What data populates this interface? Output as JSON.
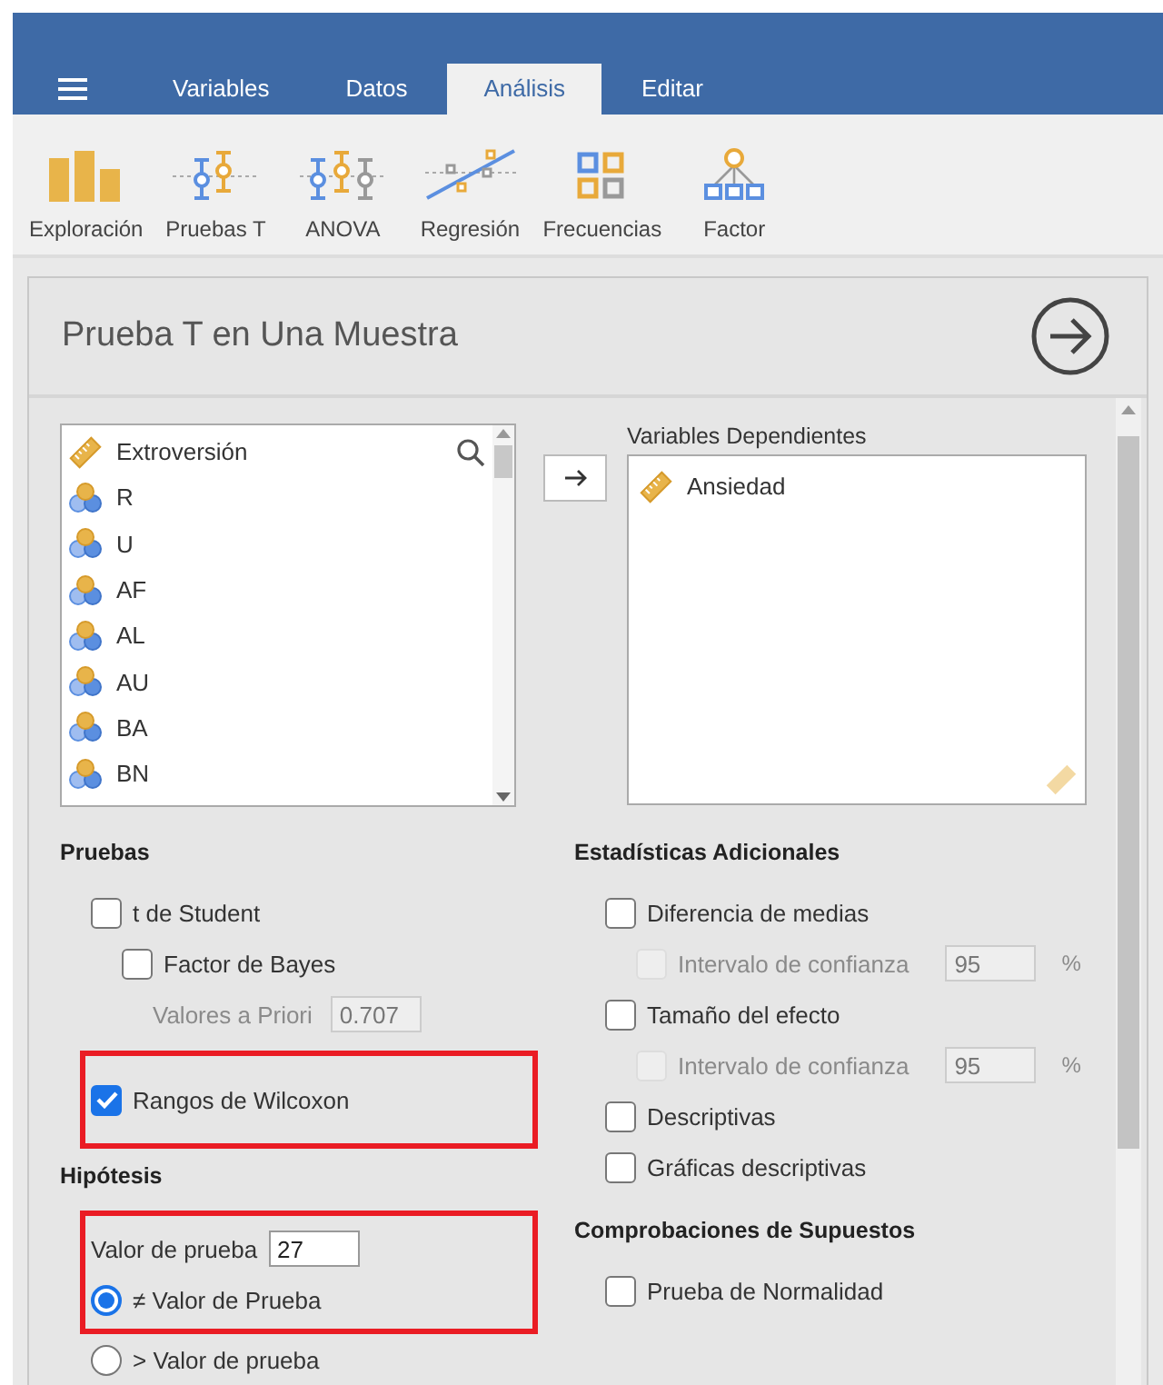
{
  "menu_tabs": [
    {
      "label": "Variables",
      "selected": false
    },
    {
      "label": "Datos",
      "selected": false
    },
    {
      "label": "Análisis",
      "selected": true
    },
    {
      "label": "Editar",
      "selected": false
    }
  ],
  "toolbar": [
    {
      "label": "Exploración",
      "kind": "bars"
    },
    {
      "label": "Pruebas T",
      "kind": "ttest"
    },
    {
      "label": "ANOVA",
      "kind": "anova"
    },
    {
      "label": "Regresión",
      "kind": "regression"
    },
    {
      "label": "Frecuencias",
      "kind": "grid"
    },
    {
      "label": "Factor",
      "kind": "tree"
    }
  ],
  "panel": {
    "title": "Prueba T en Una Muestra"
  },
  "variables": [
    {
      "name": "Extroversión",
      "kind": "continuous"
    },
    {
      "name": "R",
      "kind": "nominal"
    },
    {
      "name": "U",
      "kind": "nominal"
    },
    {
      "name": "AF",
      "kind": "nominal"
    },
    {
      "name": "AL",
      "kind": "nominal"
    },
    {
      "name": "AU",
      "kind": "nominal"
    },
    {
      "name": "BA",
      "kind": "nominal"
    },
    {
      "name": "BN",
      "kind": "nominal"
    }
  ],
  "dependent": {
    "label": "Variables Dependientes",
    "items": [
      {
        "name": "Ansiedad",
        "kind": "continuous"
      }
    ]
  },
  "tests": {
    "title": "Pruebas",
    "options": [
      {
        "kind": "check",
        "label": "t de Student",
        "checked": false,
        "children": [
          {
            "kind": "check",
            "label": "Factor de Bayes",
            "checked": false,
            "children": [
              {
                "kind": "field",
                "label": "Valores a Priori",
                "value": "0.707",
                "disabled": true
              }
            ]
          }
        ]
      },
      {
        "kind": "check",
        "label": "Rangos de Wilcoxon",
        "checked": true,
        "highlighted": true
      }
    ]
  },
  "hypothesis": {
    "title": "Hipótesis",
    "test_value_label": "Valor de prueba",
    "test_value": "27",
    "test_value_highlighted": true,
    "options": [
      {
        "label": "≠ Valor de Prueba",
        "selected": true,
        "highlighted": true
      },
      {
        "label": "> Valor de prueba",
        "selected": false
      }
    ]
  },
  "additional": {
    "title": "Estadísticas Adicionales",
    "options": [
      {
        "kind": "check",
        "label": "Diferencia de medias",
        "checked": false,
        "children": [
          {
            "kind": "check_field",
            "label": "Intervalo de confianza",
            "checked": false,
            "disabled": true,
            "value": "95",
            "unit": "%"
          }
        ]
      },
      {
        "kind": "check",
        "label": "Tamaño del efecto",
        "checked": false,
        "children": [
          {
            "kind": "check_field",
            "label": "Intervalo de confianza",
            "checked": false,
            "disabled": true,
            "value": "95",
            "unit": "%"
          }
        ]
      },
      {
        "kind": "check",
        "label": "Descriptivas",
        "checked": false
      },
      {
        "kind": "check",
        "label": "Gráficas descriptivas",
        "checked": false
      }
    ]
  },
  "assumptions": {
    "title": "Comprobaciones de Supuestos",
    "options": [
      {
        "kind": "check",
        "label": "Prueba de Normalidad",
        "checked": false
      }
    ]
  }
}
